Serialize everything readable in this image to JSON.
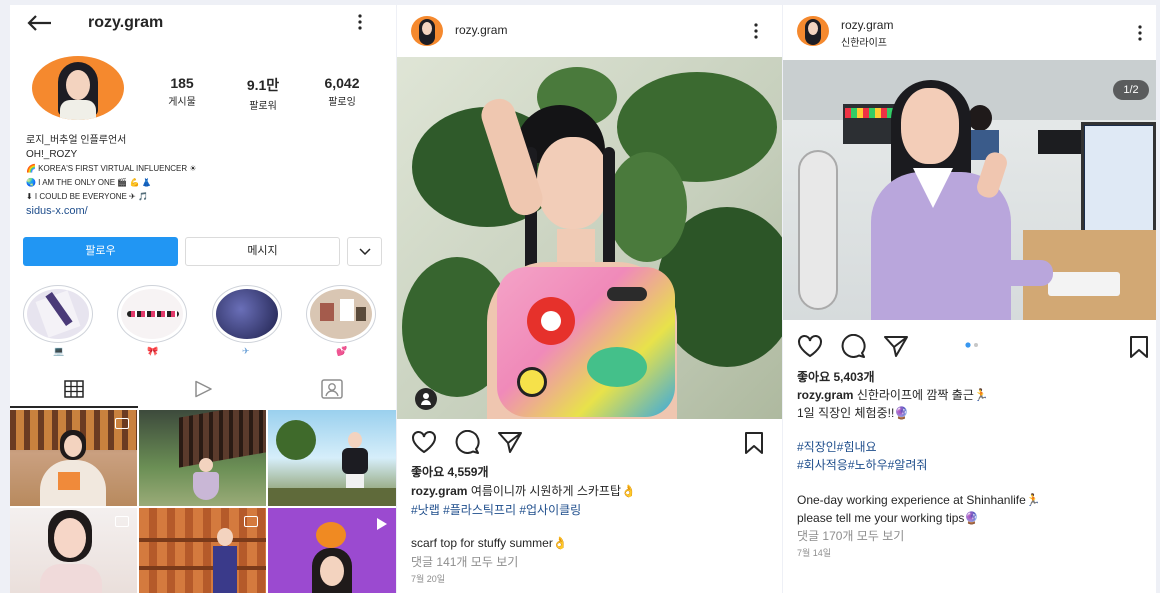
{
  "profile": {
    "username": "rozy.gram",
    "stats": [
      {
        "value": "185",
        "label": "게시물"
      },
      {
        "value": "9.1만",
        "label": "팔로워"
      },
      {
        "value": "6,042",
        "label": "팔로잉"
      }
    ],
    "bio": [
      "로지_버추얼 인플루언서",
      "OH!_ROZY",
      "🌈 KOREA'S FIRST VIRTUAL INFLUENCER ☀",
      "🌏 I AM THE ONLY ONE 🎬 💪 👗",
      "⬇ I COULD BE EVERYONE ✈ 🎵"
    ],
    "link": "sidus-x.com/",
    "follow_label": "팔로우",
    "message_label": "메시지",
    "story_emojis": [
      "💻",
      "🎀",
      "✈",
      "💕"
    ],
    "tabs": [
      "grid",
      "reels",
      "tagged"
    ]
  },
  "post1": {
    "username": "rozy.gram",
    "likes": "좋아요 4,559개",
    "caption_user": "rozy.gram",
    "caption": "여름이니까 시원하게 스카프탑👌",
    "hashtags": "#낫랩 #플라스틱프리 #업사이클링",
    "english": "scarf top for stuffy summer👌",
    "comments": "댓글 141개 모두 보기",
    "date": "7월 20일"
  },
  "post2": {
    "username": "rozy.gram",
    "location": "신한라이프",
    "counter": "1/2",
    "likes": "좋아요 5,403개",
    "caption_user": "rozy.gram",
    "caption": "신한라이프에 깜짝 출근🏃",
    "caption2": "1일 직장인 체험중!!🔮",
    "hashtags1": "#직장인#힘내요",
    "hashtags2": "#회사적응#노하우#알려줘",
    "english1": "One-day working experience at Shinhanlife🏃",
    "english2": "please tell me your working tips🔮",
    "comments": "댓글 170개 모두 보기",
    "date": "7월 14일"
  },
  "colors": {
    "follow_blue": "#2196f3",
    "avatar_orange": "#f5892e",
    "hashtag_blue": "#1f4e8c"
  }
}
